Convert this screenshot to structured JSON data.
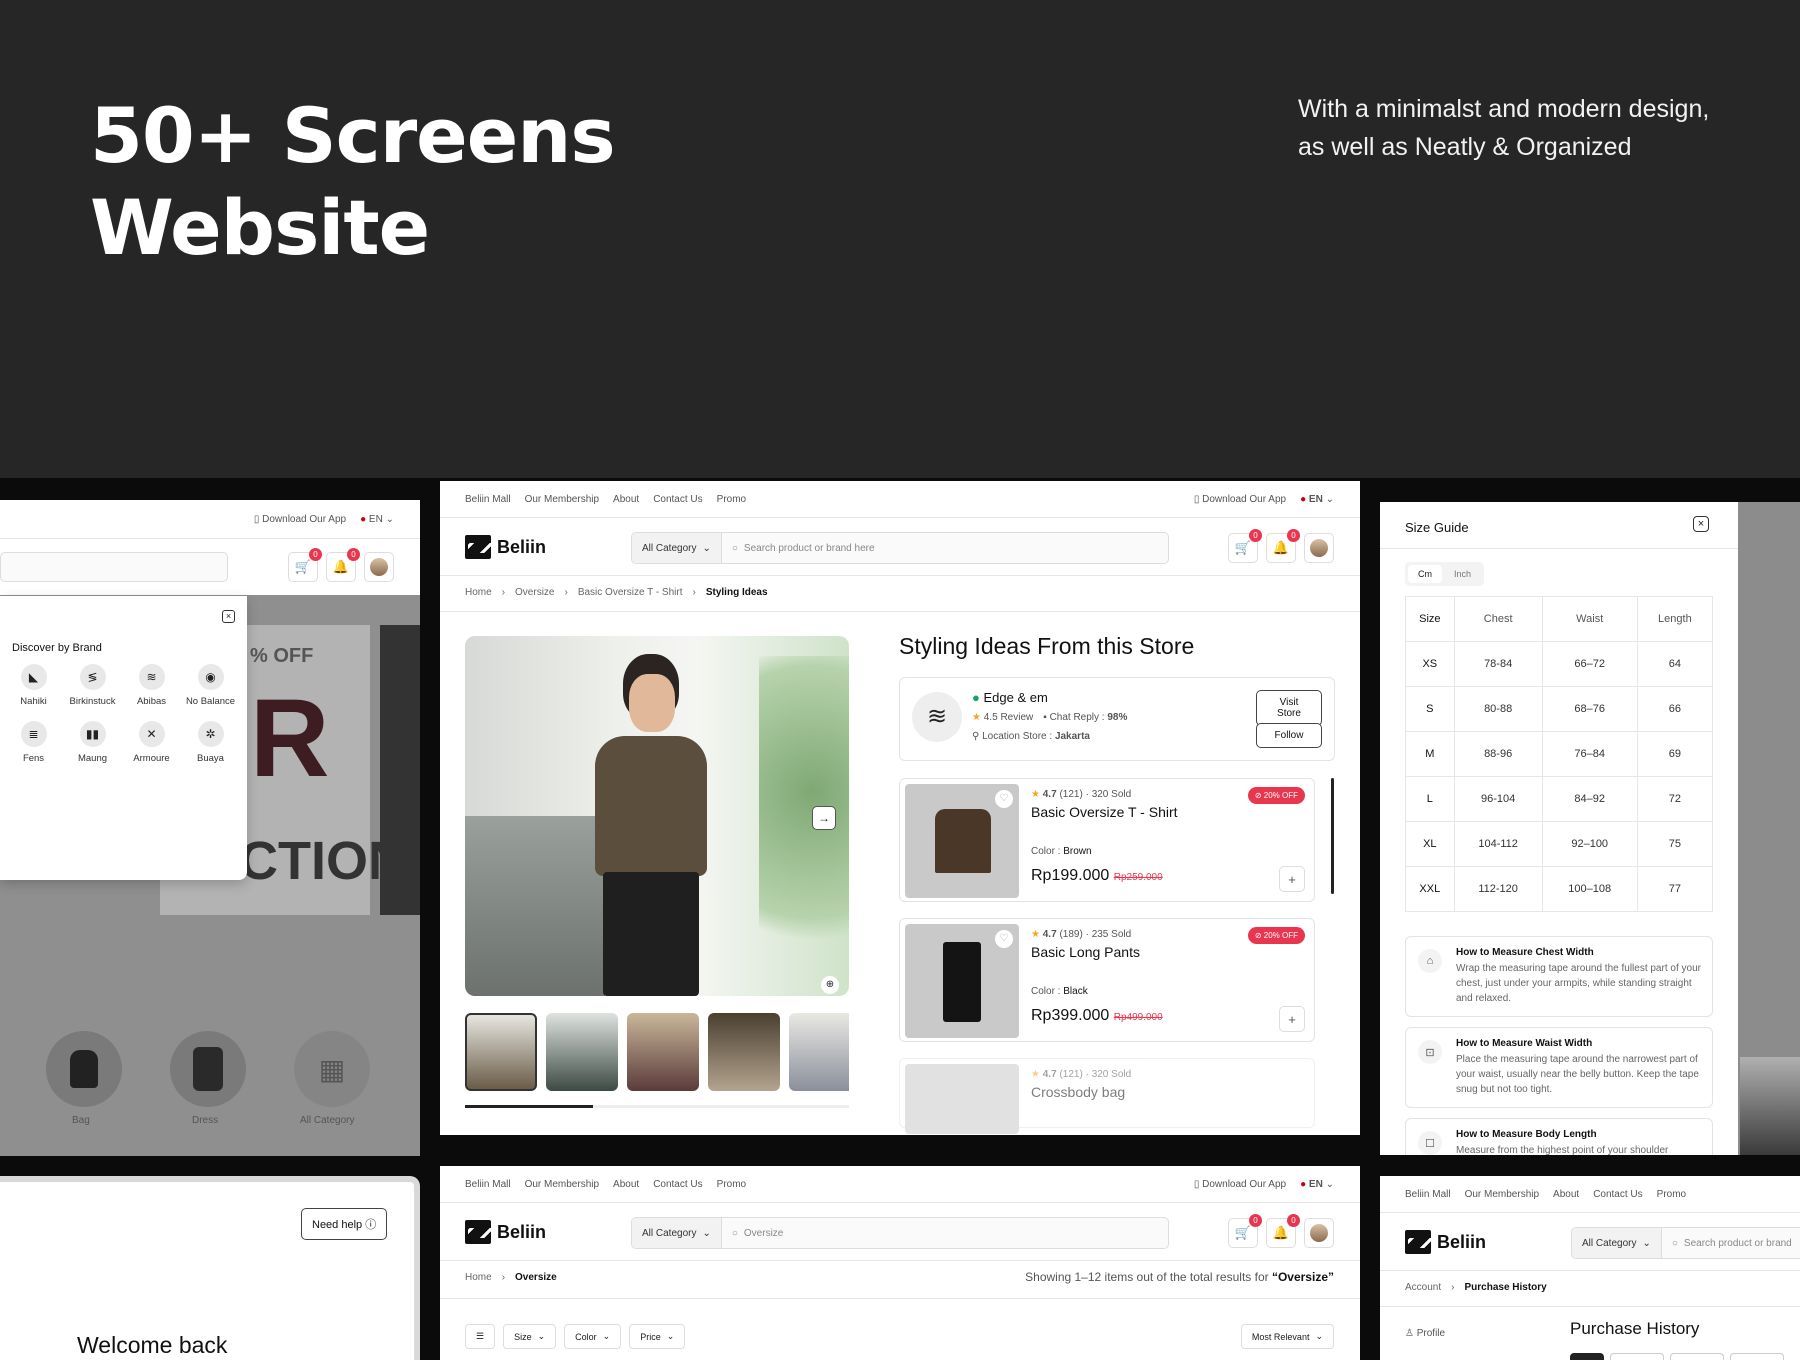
{
  "hero": {
    "title_line1": "50+ Screens",
    "title_line2": "Website",
    "subtitle_line1": "With a minimalst and modern design,",
    "subtitle_line2": "as well as Neatly & Organized"
  },
  "nav": {
    "links": [
      "Beliin Mall",
      "Our Membership",
      "About",
      "Contact Us",
      "Promo"
    ],
    "download": "Download Our App",
    "lang": "EN",
    "brand": "Beliin",
    "category": "All Category",
    "search_placeholder": "Search product or brand here",
    "cart_count": "0",
    "notif_count": "0"
  },
  "left_panel": {
    "title": "Discover by Brand",
    "brands": [
      "Nahiki",
      "Birkinstuck",
      "Abibas",
      "No Balance",
      "Fens",
      "Maung",
      "Armoure",
      "Buaya"
    ],
    "bg_text": "R",
    "bg_text2": "LECTION",
    "bg_offer": "% OFF",
    "cats": [
      "Bag",
      "Dress",
      "All Category"
    ]
  },
  "main": {
    "breadcrumb": [
      "Home",
      "Oversize",
      "Basic Oversize T - Shirt",
      "Styling Ideas"
    ],
    "heading": "Styling Ideas From this Store",
    "store": {
      "name": "Edge & em",
      "rating": "4.5",
      "review_label": "Review",
      "chat_label": "Chat Reply :",
      "chat_value": "98%",
      "loc_label": "Location Store :",
      "loc_value": "Jakarta",
      "visit": "Visit Store",
      "follow": "Follow"
    },
    "products": [
      {
        "rating": "4.7",
        "reviews": "(121)",
        "sold": "320 Sold",
        "name": "Basic Oversize T - Shirt",
        "color_label": "Color :",
        "color": "Brown",
        "price": "Rp199.000",
        "old_price": "Rp259.000",
        "discount": "20% OFF"
      },
      {
        "rating": "4.7",
        "reviews": "(189)",
        "sold": "235 Sold",
        "name": "Basic Long Pants",
        "color_label": "Color :",
        "color": "Black",
        "price": "Rp399.000",
        "old_price": "Rp499.000",
        "discount": "20% OFF"
      },
      {
        "rating": "4.7",
        "reviews": "(121)",
        "sold": "320 Sold",
        "name": "Crossbody bag"
      }
    ]
  },
  "size_guide": {
    "title": "Size Guide",
    "units": [
      "Cm",
      "Inch"
    ],
    "headers": [
      "Size",
      "Chest",
      "Waist",
      "Length"
    ],
    "rows": [
      [
        "XS",
        "78-84",
        "66–72",
        "64"
      ],
      [
        "S",
        "80-88",
        "68–76",
        "66"
      ],
      [
        "M",
        "88-96",
        "76–84",
        "69"
      ],
      [
        "L",
        "96-104",
        "84–92",
        "72"
      ],
      [
        "XL",
        "104-112",
        "92–100",
        "75"
      ],
      [
        "XXL",
        "112-120",
        "100–108",
        "77"
      ]
    ],
    "measures": [
      {
        "title": "How to Measure Chest Width",
        "text": "Wrap the measuring tape around the fullest part of your chest, just under your armpits, while standing straight and relaxed."
      },
      {
        "title": "How to Measure Waist Width",
        "text": "Place the measuring tape around the narrowest part of your waist, usually near the belly button. Keep the tape snug but not too tight."
      },
      {
        "title": "How to Measure Body Length",
        "text": "Measure from the highest point of your shoulder"
      }
    ]
  },
  "login": {
    "need_help": "Need help",
    "welcome": "Welcome back"
  },
  "search_page": {
    "query": "Oversize",
    "crumb_home": "Home",
    "crumb_cur": "Oversize",
    "showing": "Showing 1–12 items out of the total results for",
    "showing_q": "“Oversize”",
    "filters": [
      "Size",
      "Color",
      "Price"
    ],
    "sort": "Most Relevant"
  },
  "history_page": {
    "crumb": [
      "Account",
      "Purchase History"
    ],
    "title": "Purchase History",
    "profile": "Profile",
    "search_placeholder": "Search product or brand"
  }
}
